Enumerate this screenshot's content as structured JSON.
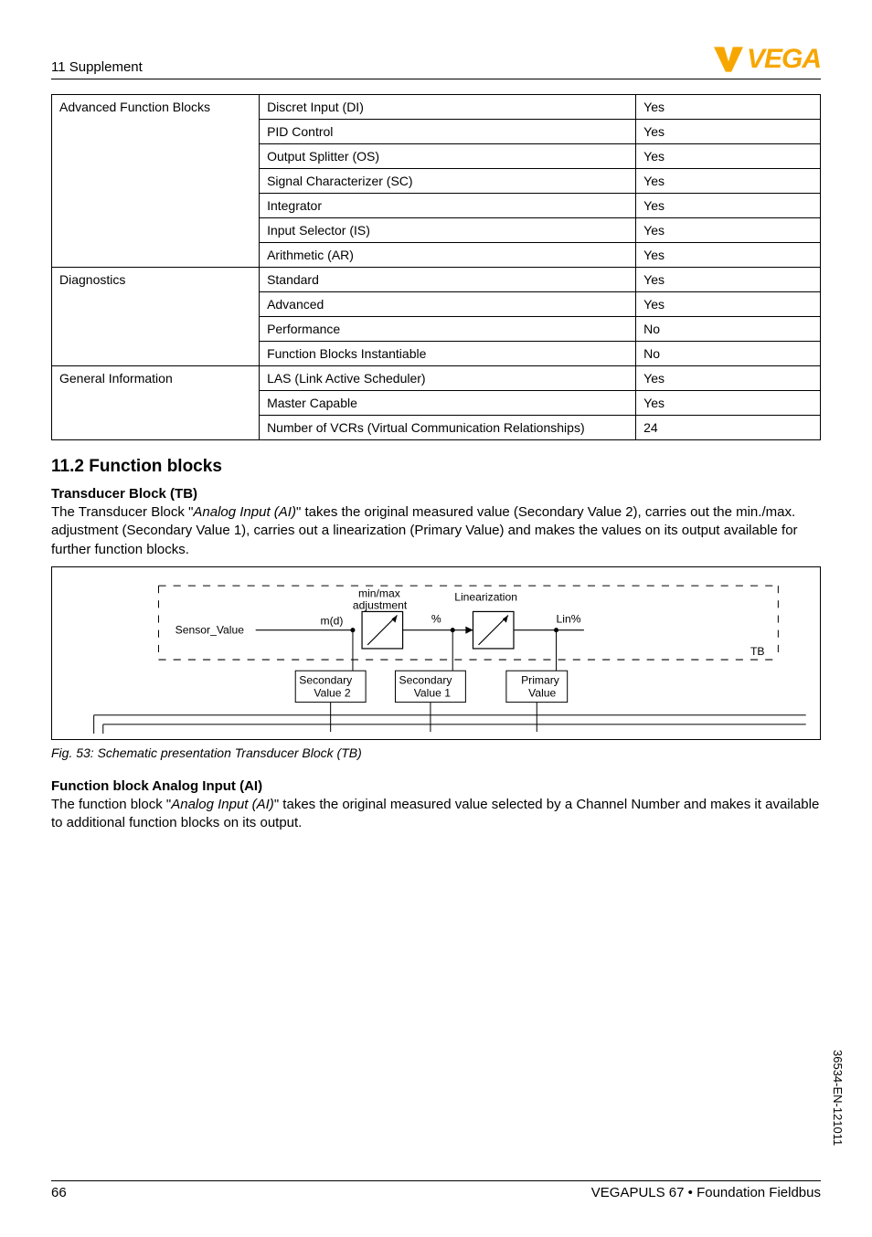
{
  "header": {
    "section": "11 Supplement",
    "logo_text": "VEGA"
  },
  "table": {
    "rows": [
      {
        "c1": "Advanced Function Blocks",
        "c2": "Discret Input (DI)",
        "c3": "Yes",
        "rowspan": 7
      },
      {
        "c2": "PID Control",
        "c3": "Yes"
      },
      {
        "c2": "Output Splitter (OS)",
        "c3": "Yes"
      },
      {
        "c2": "Signal Characterizer (SC)",
        "c3": "Yes"
      },
      {
        "c2": "Integrator",
        "c3": "Yes"
      },
      {
        "c2": "Input Selector (IS)",
        "c3": "Yes"
      },
      {
        "c2": "Arithmetic (AR)",
        "c3": "Yes"
      },
      {
        "c1": "Diagnostics",
        "c2": "Standard",
        "c3": "Yes",
        "rowspan": 4
      },
      {
        "c2": "Advanced",
        "c3": "Yes"
      },
      {
        "c2": "Performance",
        "c3": "No"
      },
      {
        "c2": "Function Blocks Instantiable",
        "c3": "No"
      },
      {
        "c1": "General Information",
        "c2": "LAS (Link Active Scheduler)",
        "c3": "Yes",
        "rowspan": 3
      },
      {
        "c2": "Master Capable",
        "c3": "Yes"
      },
      {
        "c2": "Number of VCRs (Virtual Communication Relationships)",
        "c3": "24"
      }
    ]
  },
  "section112": {
    "heading": "11.2   Function blocks",
    "tb_heading": "Transducer Block (TB)",
    "tb_text_pre": "The Transducer Block \"",
    "tb_text_em": "Analog Input (AI)",
    "tb_text_post": "\" takes the original measured value (Secondary Value 2), carries out the min./max. adjustment (Secondary Value 1), carries out a linearization (Primary Value) and makes the values on its output available for further function blocks.",
    "diagram": {
      "sensor_value": "Sensor_Value",
      "md": "m(d)",
      "minmax": "min/max",
      "adjustment": "adjustment",
      "percent": "%",
      "linearization": "Linearization",
      "lin_pct": "Lin%",
      "tb": "TB",
      "secondary": "Secondary",
      "value2": "Value 2",
      "value1": "Value 1",
      "primary": "Primary",
      "value": "Value"
    },
    "caption": "Fig. 53: Schematic presentation Transducer Block (TB)",
    "ai_heading": "Function block Analog Input (AI)",
    "ai_text_pre": "The function block \"",
    "ai_text_em": "Analog Input (AI)",
    "ai_text_post": "\" takes the original measured value selected by a Channel Number and makes it available to additional function blocks on its output."
  },
  "footer": {
    "page": "66",
    "product": "VEGAPULS 67 • Foundation Fieldbus"
  },
  "side_code": "36534-EN-121011"
}
